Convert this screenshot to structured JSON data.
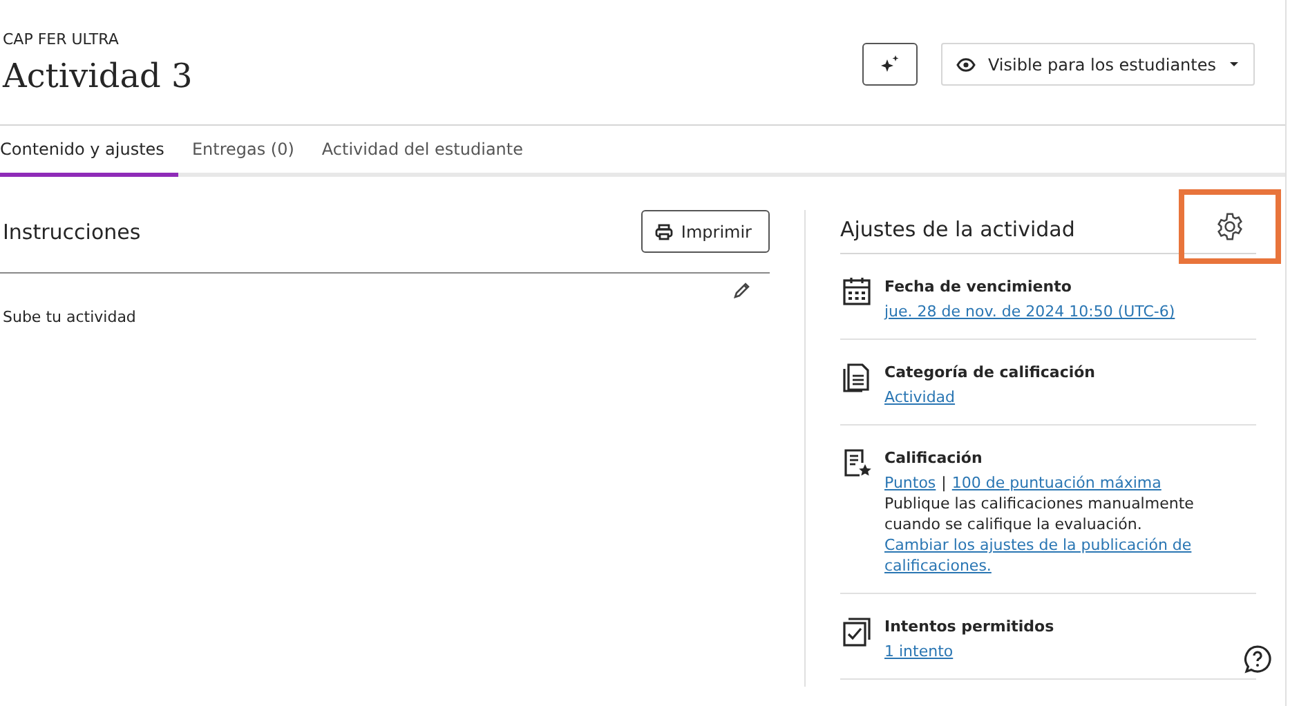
{
  "header": {
    "course": "CAP FER ULTRA",
    "title": "Actividad 3",
    "visibility": "Visible para los estudiantes"
  },
  "tabs": [
    {
      "label": "Contenido y ajustes",
      "selected": true
    },
    {
      "label": "Entregas (0)",
      "selected": false
    },
    {
      "label": "Actividad del estudiante",
      "selected": false
    }
  ],
  "instructions": {
    "heading": "Instrucciones",
    "print_button": "Imprimir",
    "text": "Sube tu actividad"
  },
  "settings": {
    "heading": "Ajustes de la actividad",
    "gear_highlighted": true,
    "items": [
      {
        "kind": "calendar",
        "title": "Fecha de vencimiento",
        "lines": [
          {
            "kind": "link",
            "text": "jue. 28 de nov. de 2024 10:50 (UTC-6)"
          }
        ]
      },
      {
        "kind": "document",
        "title": "Categoría de calificación",
        "lines": [
          {
            "kind": "link",
            "text": "Actividad"
          }
        ]
      },
      {
        "kind": "grade",
        "title": "Calificación",
        "lines": [
          {
            "kind": "links",
            "links": [
              "Puntos",
              "100 de puntuación máxima"
            ],
            "separator": "|"
          },
          {
            "kind": "text",
            "text": "Publique las calificaciones manualmente cuando se califique la evaluación."
          },
          {
            "kind": "link",
            "text": "Cambiar los ajustes de la publicación de calificaciones."
          }
        ]
      },
      {
        "kind": "attempts",
        "title": "Intentos permitidos",
        "lines": [
          {
            "kind": "link",
            "text": "1 intento"
          }
        ]
      }
    ]
  }
}
